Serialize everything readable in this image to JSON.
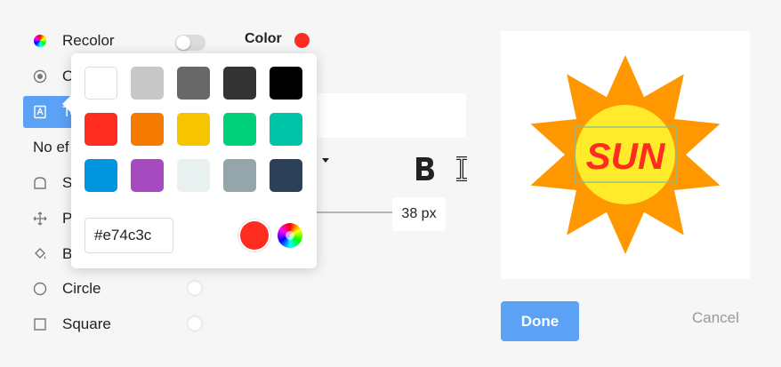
{
  "menu": {
    "recolor": "Recolor",
    "outline": "O",
    "text": "Te",
    "no_effect": "No ef",
    "shadow": "S",
    "pattern": "Pa",
    "bucket": "B",
    "circle": "Circle",
    "square": "Square"
  },
  "color_section": {
    "label": "Color",
    "current_color": "#ff2d20"
  },
  "text_controls": {
    "size_value": "38 px"
  },
  "picker": {
    "swatches": [
      "#ffffff",
      "#c8c8c8",
      "#686868",
      "#333333",
      "#000000",
      "#ff2d20",
      "#f47a00",
      "#f7c500",
      "#00d07a",
      "#00c4a7",
      "#0096df",
      "#a64bbf",
      "#e9f0f0",
      "#95a6aa",
      "#2c4159"
    ],
    "hex_value": "#e74c3c"
  },
  "preview": {
    "text": "SUN"
  },
  "actions": {
    "done": "Done",
    "cancel": "Cancel"
  }
}
